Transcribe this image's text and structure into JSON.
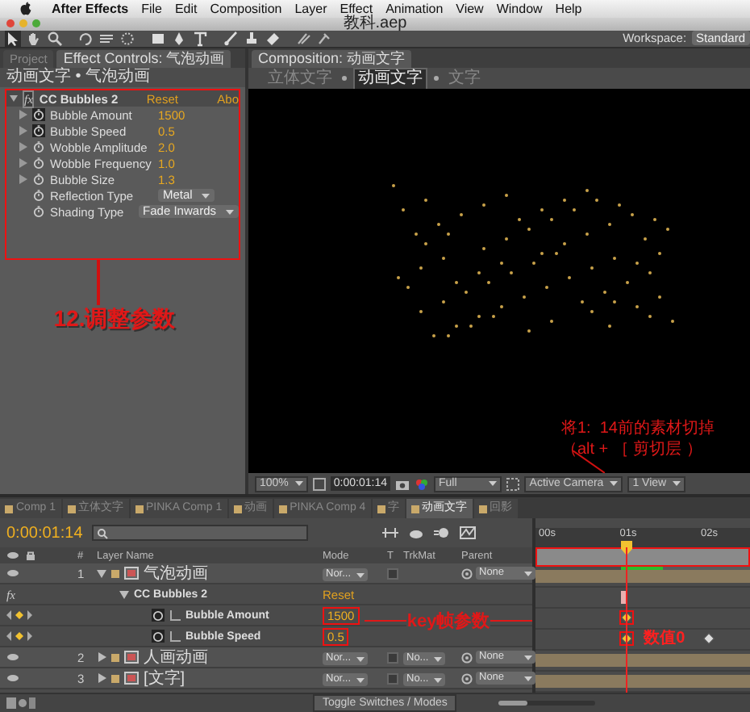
{
  "menu_bar": {
    "app": "After Effects",
    "items": [
      "File",
      "Edit",
      "Composition",
      "Layer",
      "Effect",
      "Animation",
      "View",
      "Window",
      "Help"
    ]
  },
  "window": {
    "title": "教科.aep"
  },
  "toolbar": {
    "workspace_label": "Workspace:",
    "workspace_value": "Standard"
  },
  "effect_controls": {
    "tabs": [
      {
        "label": "Project",
        "selected": false
      },
      {
        "label": "Effect Controls: 气泡动画",
        "selected": true
      }
    ],
    "breadcrumb": "动画文字 • 气泡动画",
    "effect": {
      "switch": "fx",
      "on": true,
      "name": "CC Bubbles 2",
      "reset": "Reset",
      "about": "Abo"
    },
    "params": [
      {
        "kind": "numeric",
        "name": "Bubble Amount",
        "value": "1500",
        "animated": true
      },
      {
        "kind": "numeric",
        "name": "Bubble Speed",
        "value": "0.5",
        "animated": true
      },
      {
        "kind": "numeric",
        "name": "Wobble Amplitude",
        "value": "2.0",
        "animated": false
      },
      {
        "kind": "numeric",
        "name": "Wobble Frequency",
        "value": "1.0",
        "animated": false
      },
      {
        "kind": "numeric",
        "name": "Bubble Size",
        "value": "1.3",
        "animated": false
      },
      {
        "kind": "dropdown",
        "name": "Reflection Type",
        "value": "Metal",
        "animated": false
      },
      {
        "kind": "dropdown",
        "name": "Shading Type",
        "value": "Fade Inwards",
        "animated": false
      }
    ],
    "annotation": "12.调整参数"
  },
  "composition": {
    "tab": "Composition: 动画文字",
    "breadcrumbs": [
      {
        "label": "立体文字",
        "selected": false
      },
      {
        "label": "动画文字",
        "selected": true
      },
      {
        "label": "文字",
        "selected": false
      }
    ],
    "annotation": [
      "将1:  14前的素材切掉",
      "（alt + ［ 剪切层 ）"
    ],
    "footer": {
      "zoom": "100%",
      "timecode": "0:00:01:14",
      "resolution": "Full",
      "camera": "Active Camera",
      "views": "1 View"
    }
  },
  "timeline": {
    "tabs": [
      {
        "label": "Comp 1",
        "selected": false
      },
      {
        "label": "立体文字",
        "selected": false
      },
      {
        "label": "PINKA Comp 1",
        "selected": false
      },
      {
        "label": "动画",
        "selected": false
      },
      {
        "label": "PINKA Comp 4",
        "selected": false
      },
      {
        "label": "字",
        "selected": false
      },
      {
        "label": "动画文字",
        "selected": true
      },
      {
        "label": "回影",
        "selected": false
      }
    ],
    "timecode": "0:00:01:14",
    "columns": {
      "number": "#",
      "name": "Layer Name",
      "mode": "Mode",
      "t": "T",
      "trkmat": "TrkMat",
      "parent": "Parent"
    },
    "ruler": [
      "00s",
      "01s",
      "02s"
    ],
    "cached_frames": {
      "level": 0.32
    },
    "zoom_slider": {
      "level": 0.3
    },
    "rows": [
      {
        "kind": "layer",
        "number": "1",
        "name": "气泡动画",
        "mode": "Nor...",
        "trkmat": "",
        "parent": "None",
        "expanded": true,
        "preserve_transparency": false
      },
      {
        "kind": "effect",
        "switch": "fx",
        "name": "CC Bubbles 2",
        "value": "Reset"
      },
      {
        "kind": "property",
        "name": "Bubble Amount",
        "value": "1500",
        "keyframes": [
          {
            "selected": true
          }
        ]
      },
      {
        "kind": "property",
        "name": "Bubble Speed",
        "value": "0.5",
        "keyframes": [
          {
            "selected": true
          },
          {
            "selected": false
          }
        ]
      },
      {
        "kind": "layer",
        "number": "2",
        "name": "人画动画",
        "mode": "Nor...",
        "trkmat": "No...",
        "parent": "None",
        "expanded": false,
        "preserve_transparency": false
      },
      {
        "kind": "layer",
        "number": "3",
        "name": "[文字]",
        "mode": "Nor...",
        "trkmat": "No...",
        "parent": "None",
        "expanded": false,
        "preserve_transparency": false
      }
    ],
    "annotations": {
      "keyframes": "key帧参数",
      "value": "数值0"
    },
    "footer": "Toggle Switches / Modes"
  }
}
